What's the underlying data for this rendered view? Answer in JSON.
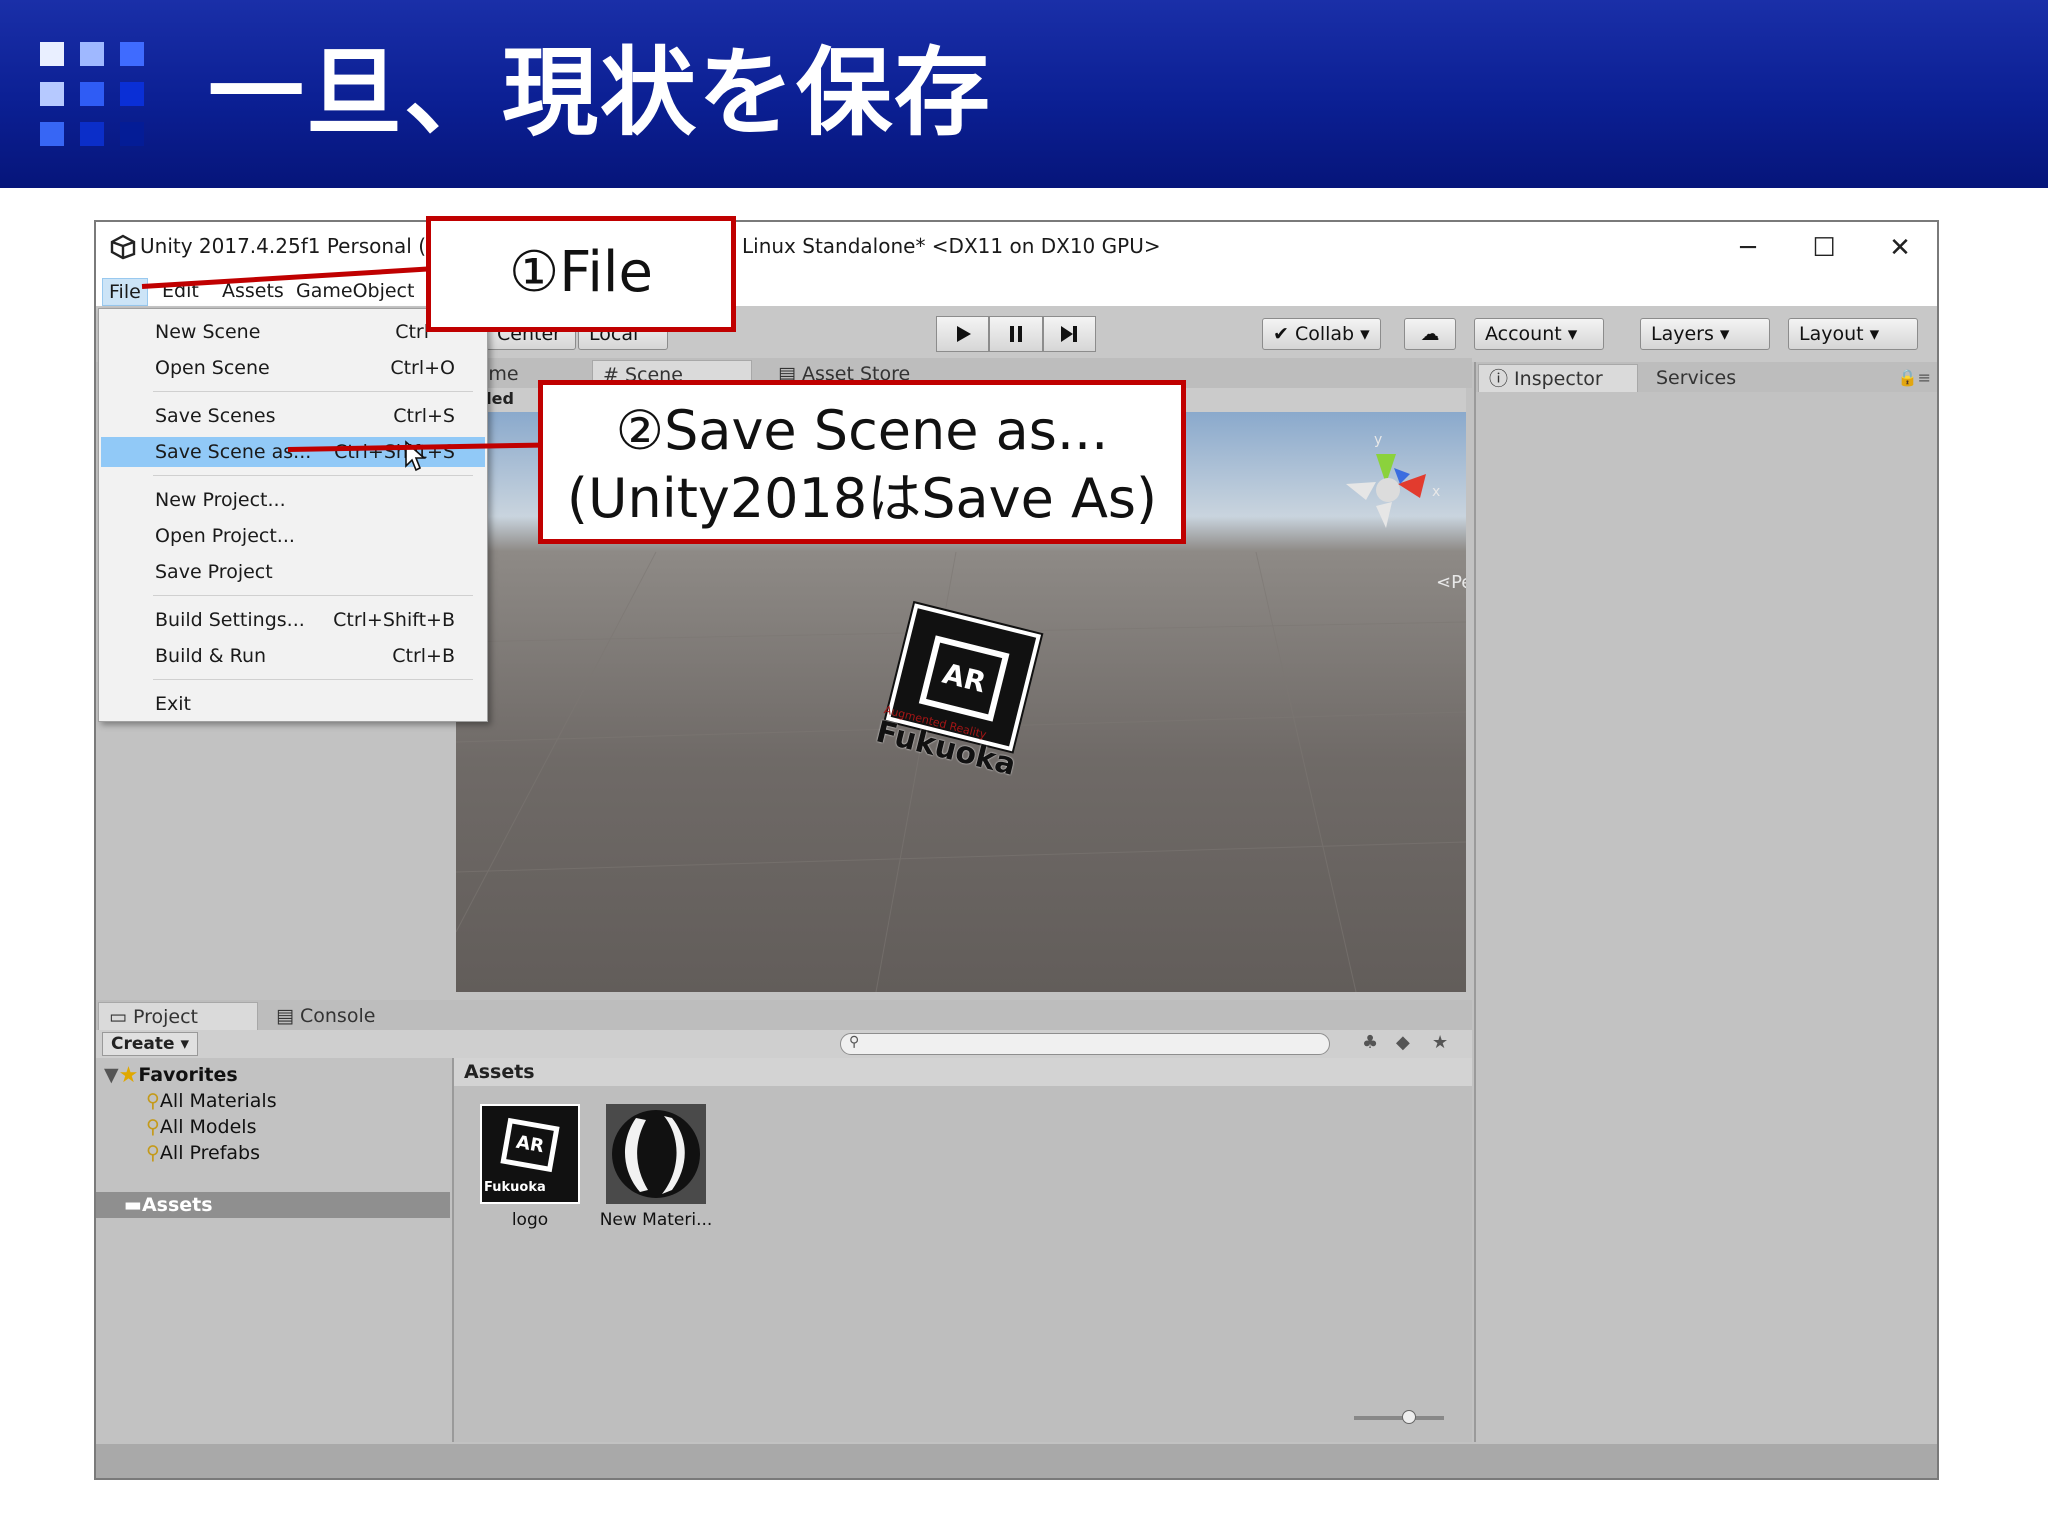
{
  "slide": {
    "title": "一旦、現状を保存",
    "colors": {
      "header_bg": "#0b1f93",
      "callout_border": "#c00000"
    }
  },
  "window": {
    "title_left": "Unity 2017.4.25f1 Personal (64bit",
    "title_right": "Linux Standalone* <DX11 on DX10 GPU>",
    "controls": {
      "minimize": "─",
      "maximize": "☐",
      "close": "✕"
    }
  },
  "menubar": [
    "File",
    "Edit",
    "Assets",
    "GameObject"
  ],
  "toolbar": {
    "center": "Center",
    "local": "Local",
    "collab": "Collab",
    "account": "Account",
    "layers": "Layers",
    "layout": "Layout"
  },
  "tabs": {
    "game": "Game",
    "scene": "Scene",
    "asset_store": "Asset Store",
    "inspector": "Inspector",
    "services": "Services",
    "project": "Project",
    "console": "Console"
  },
  "scene": {
    "shaded": "haded",
    "persp": "Persp",
    "marker_text": "AR",
    "marker_sub": "Augmented Reality",
    "marker_caption": "Fukuoka"
  },
  "file_menu": [
    {
      "label": "New Scene",
      "shortcut": "Ctrl"
    },
    {
      "label": "Open Scene",
      "shortcut": "Ctrl+O"
    },
    {
      "label": "Save Scenes",
      "shortcut": "Ctrl+S"
    },
    {
      "label": "Save Scene as...",
      "shortcut": "Ctrl+Shift+S",
      "highlighted": true
    },
    {
      "label": "New Project...",
      "shortcut": ""
    },
    {
      "label": "Open Project...",
      "shortcut": ""
    },
    {
      "label": "Save Project",
      "shortcut": ""
    },
    {
      "label": "Build Settings...",
      "shortcut": "Ctrl+Shift+B"
    },
    {
      "label": "Build & Run",
      "shortcut": "Ctrl+B"
    },
    {
      "label": "Exit",
      "shortcut": ""
    }
  ],
  "project": {
    "create": "Create",
    "favorites": "Favorites",
    "favorite_items": [
      "All Materials",
      "All Models",
      "All Prefabs"
    ],
    "assets_folder": "Assets",
    "assets_header": "Assets",
    "assets": [
      "logo",
      "New Materi..."
    ]
  },
  "callouts": {
    "file": "①File",
    "save_line1": "②Save Scene as...",
    "save_line2": "(Unity2018はSave As)"
  }
}
